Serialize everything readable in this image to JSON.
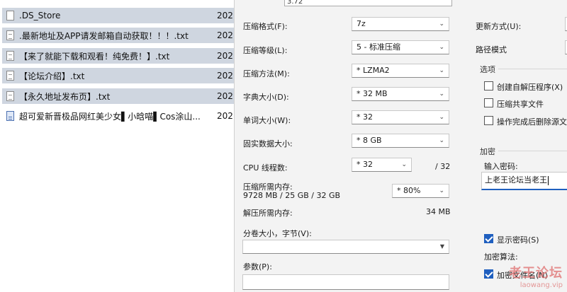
{
  "file_list": [
    {
      "name": ".DS_Store",
      "date": "202",
      "icon": "blank-file-icon"
    },
    {
      "name": ".最新地址及APP请发邮箱自动获取！！！.txt",
      "date": "202",
      "icon": "text-file-icon"
    },
    {
      "name": "【来了就能下载和观看！纯免费！】.txt",
      "date": "202",
      "icon": "text-file-icon"
    },
    {
      "name": "【论坛介绍】.txt",
      "date": "202",
      "icon": "text-file-icon"
    },
    {
      "name": "【永久地址发布页】.txt",
      "date": "202",
      "icon": "text-file-icon"
    },
    {
      "name": "超可爱新晋极品网红美少女▌小晗喵▌Cos涂山...",
      "date": "202",
      "icon": "image-file-icon"
    }
  ],
  "dialog": {
    "top_value": "3.72",
    "format": {
      "label": "压缩格式(F):",
      "value": "7z"
    },
    "level": {
      "label": "压缩等级(L):",
      "value": "5 - 标准压缩"
    },
    "method": {
      "label": "压缩方法(M):",
      "value": "*  LZMA2"
    },
    "dict": {
      "label": "字典大小(D):",
      "value": "*  32 MB"
    },
    "word": {
      "label": "单词大小(W):",
      "value": "*  32"
    },
    "solid": {
      "label": "固实数据大小:",
      "value": "*  8 GB"
    },
    "threads": {
      "label": "CPU 线程数:",
      "value": "*  32",
      "max": "/ 32"
    },
    "mem_compress": {
      "label": "压缩所需内存:",
      "detail": "9728 MB / 25 GB / 32 GB",
      "value": "*  80%"
    },
    "mem_decompress": {
      "label": "解压所需内存:",
      "value": "34 MB"
    },
    "split": {
      "label": "分卷大小，字节(V):",
      "value": ""
    },
    "params": {
      "label": "参数(P):",
      "value": ""
    },
    "update_mode_label": "更新方式(U):",
    "path_mode_label": "路径模式",
    "options": {
      "title": "选项",
      "sfx": "创建自解压程序(X)",
      "shared": "压缩共享文件",
      "delete": "操作完成后删除源文件"
    },
    "encryption": {
      "title": "加密",
      "pwd_label": "输入密码:",
      "pwd_value": "上老王论坛当老王",
      "show_pwd": "显示密码(S)",
      "algo_label": "加密算法:",
      "encrypt_names": "加密文件名(N)"
    }
  },
  "watermark": {
    "line1": "老王论坛",
    "line2": "laowang.vip"
  }
}
